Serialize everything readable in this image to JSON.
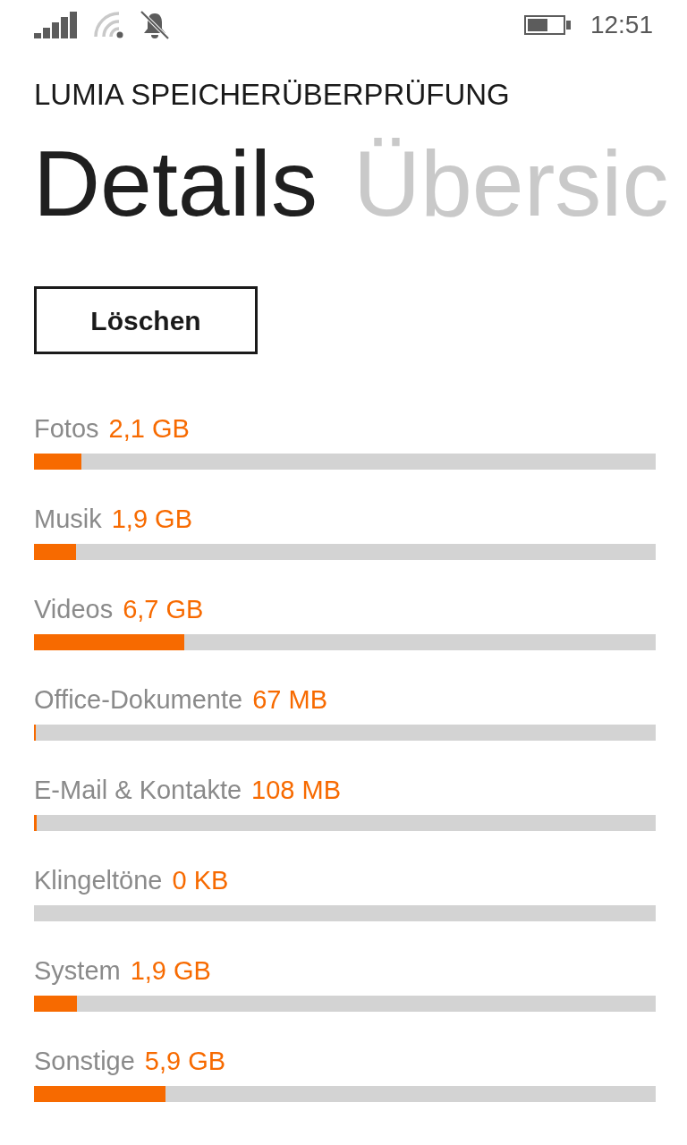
{
  "status_bar": {
    "time": "12:51"
  },
  "app_title": "LUMIA SPEICHERÜBERPRÜFUNG",
  "pivot": [
    {
      "label": "Details",
      "selected": true
    },
    {
      "label": "Übersic",
      "selected": false
    }
  ],
  "delete_button": {
    "label": "Löschen"
  },
  "categories": [
    {
      "name": "Fotos",
      "size": "2,1 GB",
      "level": 0.076
    },
    {
      "name": "Musik",
      "size": "1,9 GB",
      "level": 0.068
    },
    {
      "name": "Videos",
      "size": "6,7 GB",
      "level": 0.242
    },
    {
      "name": "Office-Dokumente",
      "size": "67 MB",
      "level": 0.003
    },
    {
      "name": "E-Mail & Kontakte",
      "size": "108 MB",
      "level": 0.004
    },
    {
      "name": "Klingeltöne",
      "size": "0 KB"
    },
    {
      "name": "System",
      "size": "1,9 GB",
      "level": 0.069
    },
    {
      "name": "Sonstige",
      "size": "5,9 GB",
      "level": 0.212
    }
  ]
}
